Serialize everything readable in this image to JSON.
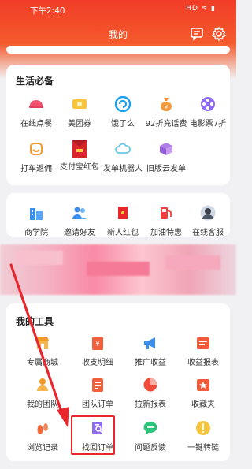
{
  "status_bar": {
    "time": "下午2:40",
    "icons": "HD ≋ ▮"
  },
  "nav": {
    "title": "我的"
  },
  "life": {
    "title": "生活必备",
    "items": [
      {
        "label": "在线点餐",
        "icon": "dining-icon"
      },
      {
        "label": "美团券",
        "icon": "ticket-icon"
      },
      {
        "label": "饿了么",
        "icon": "eleme-icon"
      },
      {
        "label": "92折充话费",
        "icon": "money-bag-icon"
      },
      {
        "label": "电影票7折",
        "icon": "film-reel-icon"
      },
      {
        "label": "打车返佣",
        "icon": "taxi-icon"
      },
      {
        "label": "支付宝红包",
        "icon": "red-envelope-icon"
      },
      {
        "label": "发单机器人",
        "icon": "cloud-icon"
      },
      {
        "label": "旧版云发单",
        "icon": "box-icon"
      }
    ]
  },
  "services": {
    "items": [
      {
        "label": "商学院",
        "icon": "building-icon"
      },
      {
        "label": "邀请好友",
        "icon": "users-icon"
      },
      {
        "label": "新人红包",
        "icon": "red-envelope-icon"
      },
      {
        "label": "加油特惠",
        "icon": "fuel-pump-icon"
      },
      {
        "label": "在线客服",
        "icon": "agent-avatar-icon"
      }
    ]
  },
  "tools": {
    "title": "我的工具",
    "items": [
      {
        "label": "专属商城",
        "icon": "shop-icon"
      },
      {
        "label": "收支明细",
        "icon": "ledger-icon"
      },
      {
        "label": "推广收益",
        "icon": "megaphone-icon"
      },
      {
        "label": "收益报表",
        "icon": "report-icon"
      },
      {
        "label": "我的团队",
        "icon": "team-icon"
      },
      {
        "label": "团队订单",
        "icon": "team-order-icon"
      },
      {
        "label": "拉新报表",
        "icon": "pie-chart-icon"
      },
      {
        "label": "收藏夹",
        "icon": "star-folder-icon"
      },
      {
        "label": "浏览记录",
        "icon": "footprint-icon"
      },
      {
        "label": "找回订单",
        "icon": "order-search-icon"
      },
      {
        "label": "问题反馈",
        "icon": "chat-bubble-icon"
      },
      {
        "label": "一键转链",
        "icon": "link-icon"
      }
    ]
  },
  "colors": {
    "brand_red": "#f23d28",
    "highlight": "#e8262c"
  }
}
